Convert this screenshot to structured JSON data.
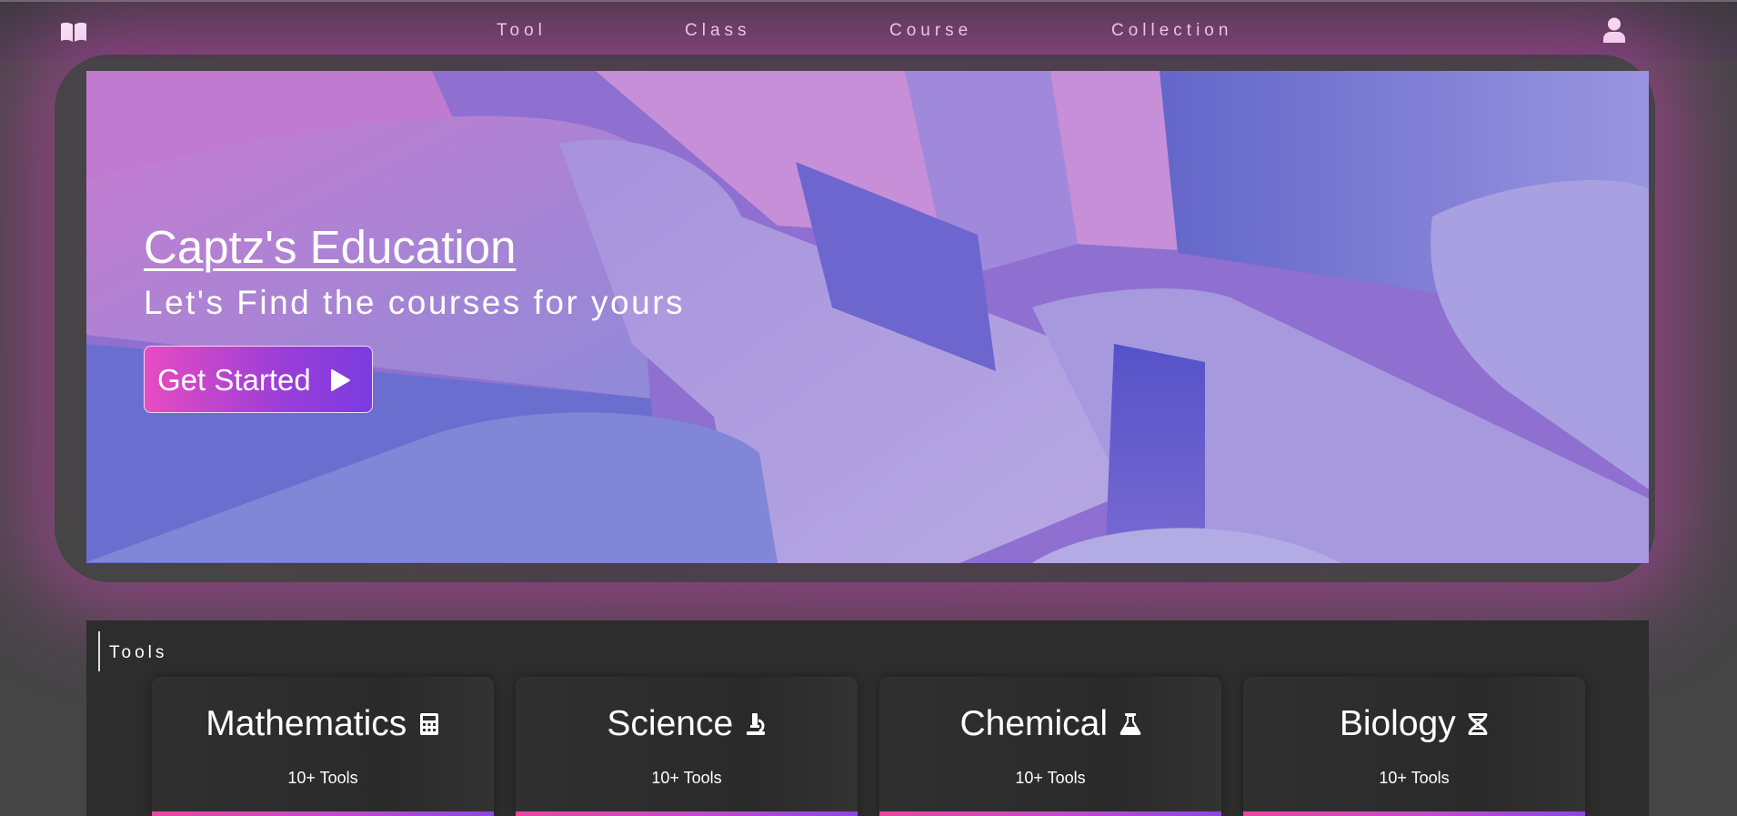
{
  "nav": {
    "brand_icon": "book-icon",
    "items": [
      "Tool",
      "Class",
      "Course",
      "Collection"
    ],
    "user_icon": "user-icon"
  },
  "hero": {
    "title": "Captz's Education",
    "subtitle": "Let's Find the courses for yours",
    "cta_label": "Get Started",
    "cta_icon": "play-icon",
    "glow_color": "#d646be",
    "cta_gradient": [
      "#e64cc2",
      "#7a3be0"
    ]
  },
  "tools": {
    "heading": "Tools",
    "cards": [
      {
        "title": "Mathematics",
        "icon": "calculator-icon",
        "count": "10+ Tools"
      },
      {
        "title": "Science",
        "icon": "microscope-icon",
        "count": "10+ Tools"
      },
      {
        "title": "Chemical",
        "icon": "flask-icon",
        "count": "10+ Tools"
      },
      {
        "title": "Biology",
        "icon": "dna-icon",
        "count": "10+ Tools"
      }
    ],
    "accent_gradient": [
      "#e8479e",
      "#8d46e0"
    ]
  }
}
